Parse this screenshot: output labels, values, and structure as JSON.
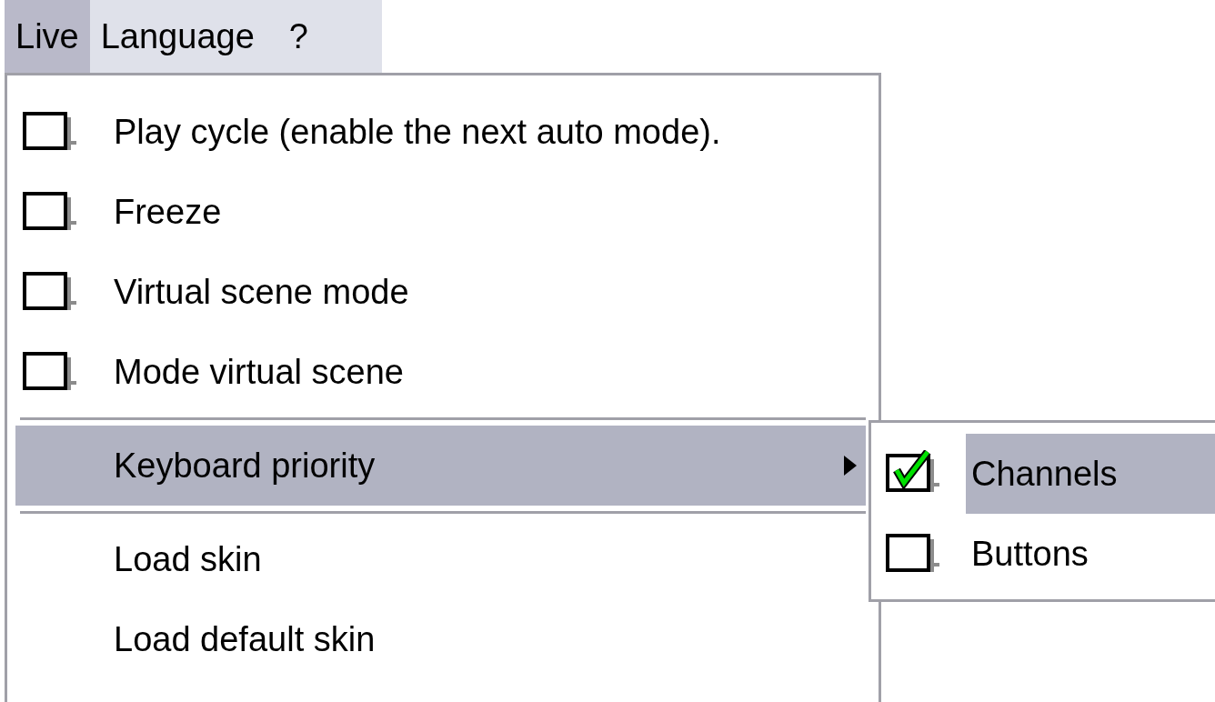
{
  "menubar": [
    {
      "label": "Live",
      "selected": true
    },
    {
      "label": "Language",
      "selected": false
    },
    {
      "label": "?",
      "selected": false
    }
  ],
  "menu": {
    "items": [
      {
        "kind": "checkbox",
        "label": "Play cycle (enable the next auto mode).",
        "checked": false,
        "selected": false
      },
      {
        "kind": "checkbox",
        "label": "Freeze",
        "checked": false,
        "selected": false
      },
      {
        "kind": "checkbox",
        "label": "Virtual scene mode",
        "checked": false,
        "selected": false
      },
      {
        "kind": "checkbox",
        "label": "Mode virtual scene",
        "checked": false,
        "selected": false
      },
      {
        "kind": "separator"
      },
      {
        "kind": "submenu",
        "label": "Keyboard priority",
        "selected": true
      },
      {
        "kind": "separator"
      },
      {
        "kind": "command",
        "label": "Load skin",
        "selected": false
      },
      {
        "kind": "command",
        "label": "Load default skin",
        "selected": false
      }
    ]
  },
  "submenu": {
    "items": [
      {
        "label": "Channels",
        "checked": true,
        "selected": true
      },
      {
        "label": "Buttons",
        "checked": false,
        "selected": false
      }
    ]
  }
}
